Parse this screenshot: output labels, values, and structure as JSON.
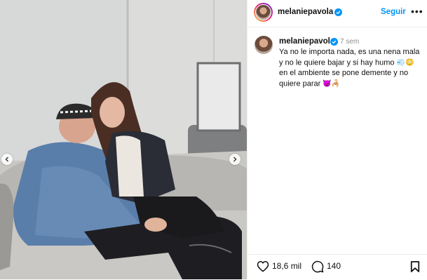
{
  "post": {
    "username": "melaniepavola",
    "follow_label": "Seguir",
    "more_label": "•••",
    "time_ago": "7 sem",
    "caption_text_1": "Ya no le importa nada, es una nena mala y no le quiere bajar y si hay humo ",
    "caption_text_2": " en el ambiente se pone demente y no quiere parar ",
    "emoji_1": "💨😳",
    "emoji_2": "😈🦂",
    "likes": "18,6 mil",
    "comments": "140"
  },
  "colors": {
    "accent": "#0095f6",
    "text": "#111111",
    "muted": "#8e8e8e",
    "border": "#efefef"
  },
  "icons": [
    "heart-icon",
    "comment-icon",
    "bookmark-icon",
    "verified-icon",
    "chevron-left-icon",
    "chevron-right-icon"
  ]
}
